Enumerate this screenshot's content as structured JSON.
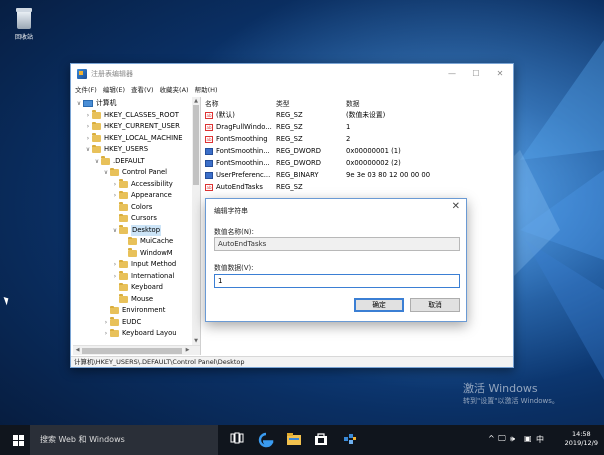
{
  "desktop": {
    "recycle_bin_label": "回收站"
  },
  "window": {
    "title": "注册表编辑器",
    "controls": {
      "minimize": "—",
      "maximize": "☐",
      "close": "✕"
    },
    "menu": [
      "文件(F)",
      "编辑(E)",
      "查看(V)",
      "收藏夹(A)",
      "帮助(H)"
    ]
  },
  "tree": [
    {
      "label": "计算机",
      "depth": 0,
      "chev": "∨",
      "icon": "pc"
    },
    {
      "label": "HKEY_CLASSES_ROOT",
      "depth": 1,
      "chev": "›",
      "icon": "folder"
    },
    {
      "label": "HKEY_CURRENT_USER",
      "depth": 1,
      "chev": "›",
      "icon": "folder"
    },
    {
      "label": "HKEY_LOCAL_MACHINE",
      "depth": 1,
      "chev": "›",
      "icon": "folder"
    },
    {
      "label": "HKEY_USERS",
      "depth": 1,
      "chev": "∨",
      "icon": "folder"
    },
    {
      "label": ".DEFAULT",
      "depth": 2,
      "chev": "∨",
      "icon": "folder"
    },
    {
      "label": "Control Panel",
      "depth": 3,
      "chev": "∨",
      "icon": "folder"
    },
    {
      "label": "Accessibility",
      "depth": 4,
      "chev": "›",
      "icon": "folder"
    },
    {
      "label": "Appearance",
      "depth": 4,
      "chev": "›",
      "icon": "folder"
    },
    {
      "label": "Colors",
      "depth": 4,
      "chev": "",
      "icon": "folder"
    },
    {
      "label": "Cursors",
      "depth": 4,
      "chev": "",
      "icon": "folder"
    },
    {
      "label": "Desktop",
      "depth": 4,
      "chev": "∨",
      "icon": "folder",
      "selected": true
    },
    {
      "label": "MuiCache",
      "depth": 5,
      "chev": "",
      "icon": "folder"
    },
    {
      "label": "WindowM",
      "depth": 5,
      "chev": "",
      "icon": "folder"
    },
    {
      "label": "Input Method",
      "depth": 4,
      "chev": "›",
      "icon": "folder"
    },
    {
      "label": "International",
      "depth": 4,
      "chev": "›",
      "icon": "folder"
    },
    {
      "label": "Keyboard",
      "depth": 4,
      "chev": "",
      "icon": "folder"
    },
    {
      "label": "Mouse",
      "depth": 4,
      "chev": "",
      "icon": "folder"
    },
    {
      "label": "Environment",
      "depth": 3,
      "chev": "",
      "icon": "folder"
    },
    {
      "label": "EUDC",
      "depth": 3,
      "chev": "›",
      "icon": "folder"
    },
    {
      "label": "Keyboard Layou",
      "depth": 3,
      "chev": "›",
      "icon": "folder"
    }
  ],
  "list": {
    "headers": {
      "name": "名称",
      "type": "类型",
      "data": "数据"
    },
    "rows": [
      {
        "name": "(默认)",
        "type": "REG_SZ",
        "data": "(数值未设置)",
        "icon": "sz"
      },
      {
        "name": "DragFullWindo...",
        "type": "REG_SZ",
        "data": "1",
        "icon": "sz"
      },
      {
        "name": "FontSmoothing",
        "type": "REG_SZ",
        "data": "2",
        "icon": "sz"
      },
      {
        "name": "FontSmoothin...",
        "type": "REG_DWORD",
        "data": "0x00000001 (1)",
        "icon": "dw"
      },
      {
        "name": "FontSmoothin...",
        "type": "REG_DWORD",
        "data": "0x00000002 (2)",
        "icon": "dw"
      },
      {
        "name": "UserPreferenc...",
        "type": "REG_BINARY",
        "data": "9e 3e 03 80 12 00 00 00",
        "icon": "bn"
      },
      {
        "name": "AutoEndTasks",
        "type": "REG_SZ",
        "data": "",
        "icon": "sz"
      }
    ]
  },
  "statusbar": "计算机\\HKEY_USERS\\.DEFAULT\\Control Panel\\Desktop",
  "dialog": {
    "title": "编辑字符串",
    "close": "✕",
    "name_label": "数值名称(N):",
    "name_value": "AutoEndTasks",
    "data_label": "数值数据(V):",
    "data_value": "1",
    "ok": "确定",
    "cancel": "取消"
  },
  "watermark": {
    "line1": "激活 Windows",
    "line2": "转到\"设置\"以激活 Windows。"
  },
  "taskbar": {
    "search_placeholder": "搜索 Web 和 Windows",
    "tray": {
      "chevron": "^",
      "network": "🖵",
      "volume": "🕪",
      "ime_icon": "▣",
      "ime": "中"
    },
    "time": "14:58",
    "date": "2019/12/9"
  }
}
